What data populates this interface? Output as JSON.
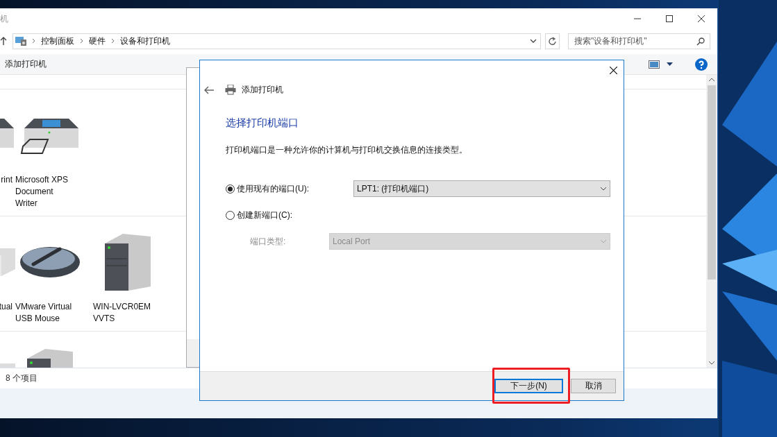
{
  "explorer": {
    "title": "机",
    "crumbs": [
      "控制面板",
      "硬件",
      "设备和打印机"
    ],
    "search": {
      "placeholder": "搜索\"设备和打印机\""
    },
    "toolbar": {
      "add_printer": "添加打印机"
    },
    "device_rows": [
      {
        "items": [
          {
            "label": "rint",
            "kind": "printer"
          },
          {
            "label": "Microsoft XPS Document Writer",
            "kind": "printer"
          }
        ]
      },
      {
        "items": [
          {
            "label": "tual",
            "kind": "box"
          },
          {
            "label": "VMware Virtual USB Mouse",
            "kind": "mouse"
          },
          {
            "label": "WIN-LVCR0EM VVTS",
            "kind": "server"
          }
        ]
      },
      {
        "items": [
          {
            "kind": "box"
          },
          {
            "kind": "server"
          }
        ]
      }
    ],
    "status_bar": "8 个项目"
  },
  "dialog": {
    "title": "添加打印机",
    "heading": "选择打印机端口",
    "description": "打印机端口是一种允许你的计算机与打印机交换信息的连接类型。",
    "options": [
      {
        "label": "使用现有的端口(U):",
        "selected": true,
        "value": "LPT1: (打印机端口)"
      },
      {
        "label": "创建新端口(C):",
        "selected": false
      }
    ],
    "port_type": {
      "label": "端口类型:",
      "value": "Local Port",
      "disabled": true
    },
    "buttons": [
      {
        "label": "下一步(N)",
        "kind": "primary",
        "highlighted": true
      },
      {
        "label": "取消",
        "kind": "secondary"
      }
    ]
  }
}
